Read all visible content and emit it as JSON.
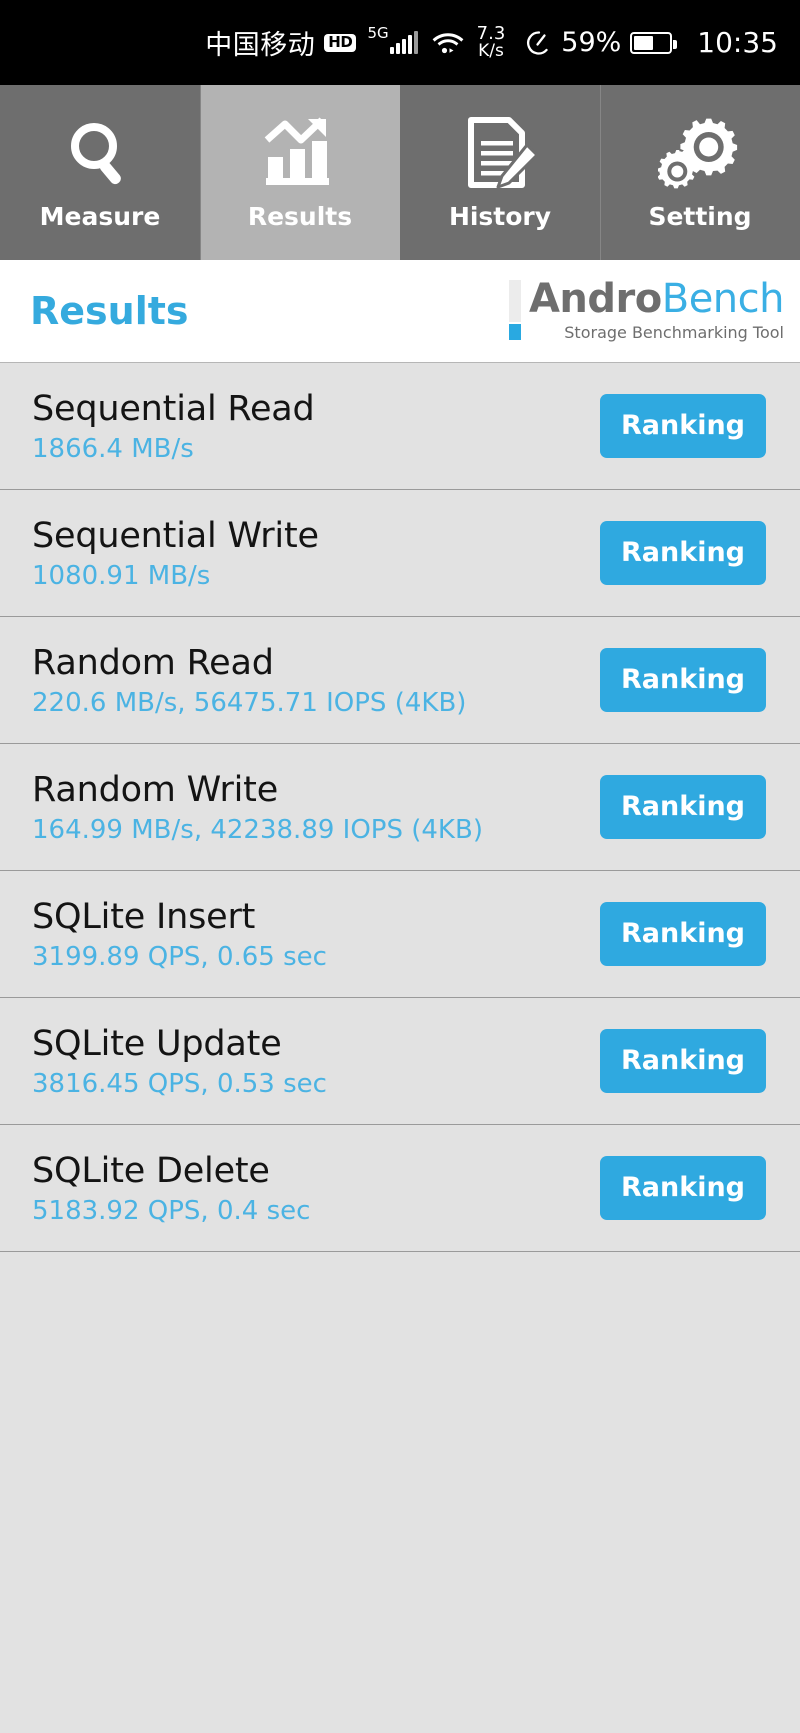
{
  "statusbar": {
    "carrier": "中国移动",
    "hd_badge": "HD",
    "network_type": "5G",
    "net_speed_value": "7.3",
    "net_speed_unit": "K/s",
    "battery_percent": "59%",
    "time": "10:35",
    "icons": [
      "hd-icon",
      "signal-bars-icon",
      "wifi-icon",
      "data-saver-icon",
      "battery-icon"
    ]
  },
  "tabs": [
    {
      "label": "Measure",
      "icon": "magnifier-icon",
      "active": false
    },
    {
      "label": "Results",
      "icon": "bar-chart-icon",
      "active": true
    },
    {
      "label": "History",
      "icon": "document-pencil-icon",
      "active": false
    },
    {
      "label": "Setting",
      "icon": "gears-icon",
      "active": false
    }
  ],
  "header": {
    "title": "Results",
    "logo_andro": "Andro",
    "logo_bench": "Bench",
    "logo_tagline": "Storage Benchmarking Tool"
  },
  "results": {
    "ranking_label": "Ranking",
    "rows": [
      {
        "name": "Sequential Read",
        "value": "1866.4 MB/s"
      },
      {
        "name": "Sequential Write",
        "value": "1080.91 MB/s"
      },
      {
        "name": "Random Read",
        "value": "220.6 MB/s, 56475.71 IOPS (4KB)"
      },
      {
        "name": "Random Write",
        "value": "164.99 MB/s, 42238.89 IOPS (4KB)"
      },
      {
        "name": "SQLite Insert",
        "value": "3199.89 QPS, 0.65 sec"
      },
      {
        "name": "SQLite Update",
        "value": "3816.45 QPS, 0.53 sec"
      },
      {
        "name": "SQLite Delete",
        "value": "5183.92 QPS, 0.4 sec"
      }
    ]
  },
  "colors": {
    "accent_blue": "#2fa9e0",
    "value_blue": "#4bb3e3",
    "tab_inactive": "#6e6e6e",
    "tab_active": "#b3b3b3",
    "list_bg": "#e2e2e2"
  }
}
